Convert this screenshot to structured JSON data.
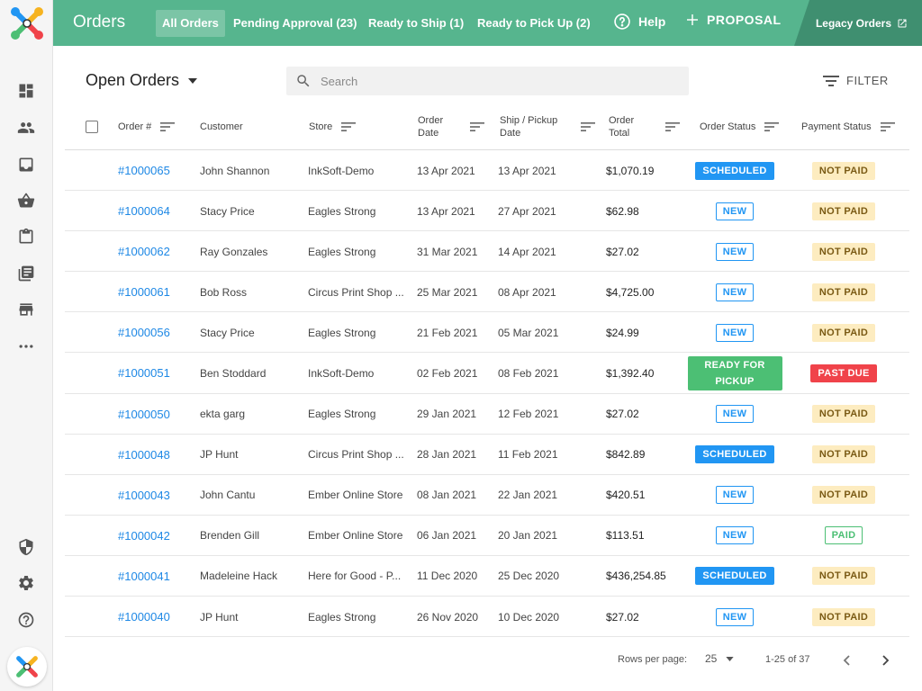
{
  "header": {
    "title": "Orders",
    "tabs": [
      {
        "label": "All Orders",
        "active": true
      },
      {
        "label": "Pending Approval (23)",
        "active": false
      },
      {
        "label": "Ready to Ship (1)",
        "active": false
      },
      {
        "label": "Ready to Pick Up (2)",
        "active": false
      }
    ],
    "help_label": "Help",
    "proposal_label": "PROPOSAL",
    "legacy_label": "Legacy Orders",
    "accent_color": "#56b58e"
  },
  "sidebar": {
    "icons": [
      "dashboard-icon",
      "people-icon",
      "inbox-icon",
      "basket-icon",
      "clipboard-icon",
      "catalog-icon",
      "store-icon",
      "more-icon",
      "shield-icon",
      "gear-icon",
      "help-circle-icon"
    ]
  },
  "toolbar": {
    "view_label": "Open Orders",
    "search_placeholder": "Search",
    "filter_label": "FILTER"
  },
  "table": {
    "columns": {
      "order": "Order #",
      "customer": "Customer",
      "store": "Store",
      "order_date": "Order Date",
      "ship_date": "Ship / Pickup Date",
      "total": "Order Total",
      "order_status": "Order Status",
      "payment_status": "Payment Status"
    },
    "rows": [
      {
        "order": "#1000065",
        "customer": "John Shannon",
        "store": "InkSoft-Demo",
        "order_date": "13 Apr 2021",
        "ship_date": "13 Apr 2021",
        "total": "$1,070.19",
        "order_status": "SCHEDULED",
        "payment_status": "NOT PAID"
      },
      {
        "order": "#1000064",
        "customer": "Stacy Price",
        "store": "Eagles Strong",
        "order_date": "13 Apr 2021",
        "ship_date": "27 Apr 2021",
        "total": "$62.98",
        "order_status": "NEW",
        "payment_status": "NOT PAID"
      },
      {
        "order": "#1000062",
        "customer": "Ray Gonzales",
        "store": "Eagles Strong",
        "order_date": "31 Mar 2021",
        "ship_date": "14 Apr 2021",
        "total": "$27.02",
        "order_status": "NEW",
        "payment_status": "NOT PAID"
      },
      {
        "order": "#1000061",
        "customer": "Bob Ross",
        "store": "Circus Print Shop ...",
        "order_date": "25 Mar 2021",
        "ship_date": "08 Apr 2021",
        "total": "$4,725.00",
        "order_status": "NEW",
        "payment_status": "NOT PAID"
      },
      {
        "order": "#1000056",
        "customer": "Stacy Price",
        "store": "Eagles Strong",
        "order_date": "21 Feb 2021",
        "ship_date": "05 Mar 2021",
        "total": "$24.99",
        "order_status": "NEW",
        "payment_status": "NOT PAID"
      },
      {
        "order": "#1000051",
        "customer": "Ben Stoddard",
        "store": "InkSoft-Demo",
        "order_date": "02 Feb 2021",
        "ship_date": "08 Feb 2021",
        "total": "$1,392.40",
        "order_status": "READY FOR PICKUP",
        "payment_status": "PAST DUE"
      },
      {
        "order": "#1000050",
        "customer": "ekta garg",
        "store": "Eagles Strong",
        "order_date": "29 Jan 2021",
        "ship_date": "12 Feb 2021",
        "total": "$27.02",
        "order_status": "NEW",
        "payment_status": "NOT PAID"
      },
      {
        "order": "#1000048",
        "customer": "JP Hunt",
        "store": "Circus Print Shop ...",
        "order_date": "28 Jan 2021",
        "ship_date": "11 Feb 2021",
        "total": "$842.89",
        "order_status": "SCHEDULED",
        "payment_status": "NOT PAID"
      },
      {
        "order": "#1000043",
        "customer": "John Cantu",
        "store": "Ember Online Store",
        "order_date": "08 Jan 2021",
        "ship_date": "22 Jan 2021",
        "total": "$420.51",
        "order_status": "NEW",
        "payment_status": "NOT PAID"
      },
      {
        "order": "#1000042",
        "customer": "Brenden Gill",
        "store": "Ember Online Store",
        "order_date": "06 Jan 2021",
        "ship_date": "20 Jan 2021",
        "total": "$113.51",
        "order_status": "NEW",
        "payment_status": "PAID"
      },
      {
        "order": "#1000041",
        "customer": "Madeleine Hack",
        "store": "Here for Good - P...",
        "order_date": "11 Dec 2020",
        "ship_date": "25 Dec 2020",
        "total": "$436,254.85",
        "order_status": "SCHEDULED",
        "payment_status": "NOT PAID"
      },
      {
        "order": "#1000040",
        "customer": "JP Hunt",
        "store": "Eagles Strong",
        "order_date": "26 Nov 2020",
        "ship_date": "10 Dec 2020",
        "total": "$27.02",
        "order_status": "NEW",
        "payment_status": "NOT PAID"
      }
    ]
  },
  "pagination": {
    "rows_per_page_label": "Rows per page:",
    "rows_per_page_value": "25",
    "range_label": "1-25 of 37"
  }
}
